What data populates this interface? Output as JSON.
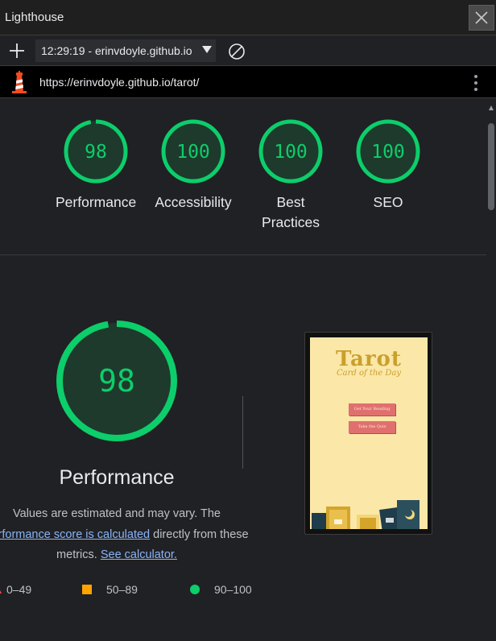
{
  "window": {
    "title": "Lighthouse"
  },
  "toolbar": {
    "report_label": "12:29:19 - erinvdoyle.github.io"
  },
  "urlbar": {
    "url": "https://erinvdoyle.github.io/tarot/"
  },
  "colors": {
    "pass": "#0cce6b",
    "pass_fill": "#1e3a2c",
    "average": "#ffa400",
    "fail": "#ff4e42"
  },
  "summary": [
    {
      "score": "98",
      "label": "Performance",
      "value": 98
    },
    {
      "score": "100",
      "label": "Accessibility",
      "value": 100
    },
    {
      "score": "100",
      "label": "Best Practices",
      "value": 100
    },
    {
      "score": "100",
      "label": "SEO",
      "value": 100
    }
  ],
  "performance": {
    "score": "98",
    "value": 98,
    "title": "Performance",
    "desc_1": "Values are estimated and may vary. The",
    "desc_link": "performance score is calculated",
    "desc_2": "directly from these",
    "desc_3": "metrics.",
    "desc_link2": "See calculator."
  },
  "legend": [
    {
      "range": "0–49",
      "color": "#ff4e42"
    },
    {
      "range": "50–89",
      "color": "#ffa400"
    },
    {
      "range": "90–100",
      "color": "#0cce6b"
    }
  ],
  "screenshot": {
    "title": "Tarot",
    "subtitle": "Card of the Day",
    "button1": "Get Your Reading",
    "button2": "Take the Quiz"
  }
}
